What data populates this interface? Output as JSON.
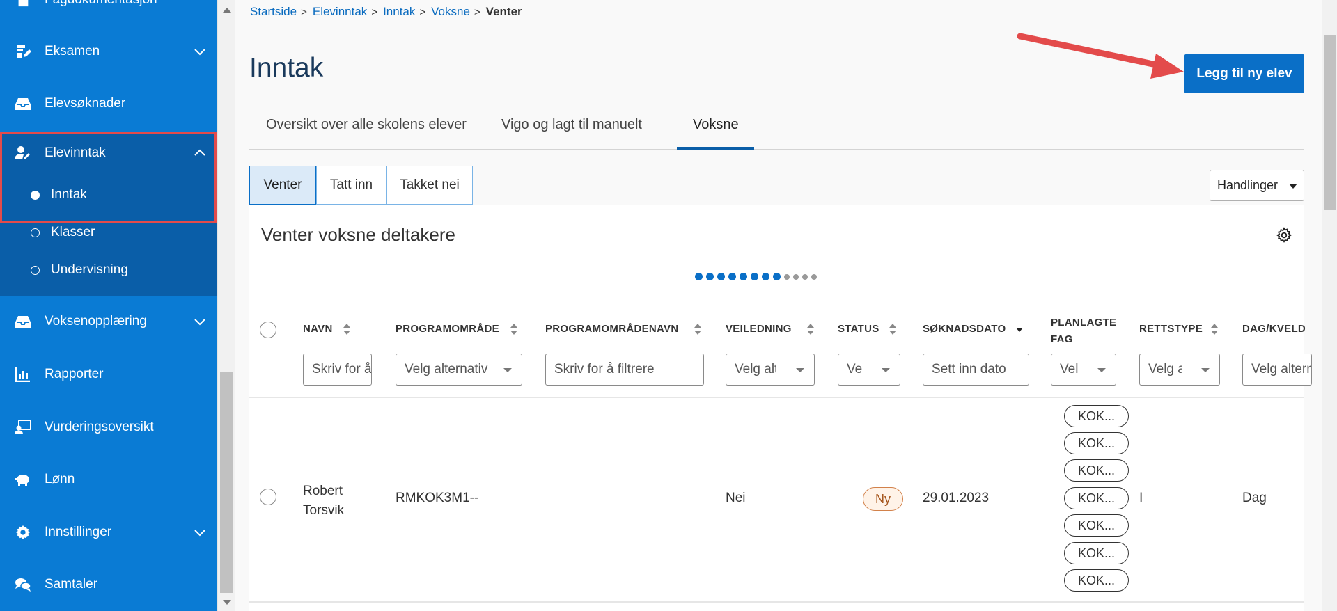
{
  "sidebar": {
    "items": [
      {
        "label": "Fagdokumentasjon",
        "icon": "document-icon"
      },
      {
        "label": "Eksamen",
        "icon": "exam-edit-icon"
      },
      {
        "label": "Elevsøknader",
        "icon": "inbox-icon"
      },
      {
        "label": "Elevinntak",
        "icon": "user-edit-icon"
      },
      {
        "label": "Voksenopplæring",
        "icon": "inbox-icon"
      },
      {
        "label": "Rapporter",
        "icon": "bar-chart-icon"
      },
      {
        "label": "Vurderingsoversikt",
        "icon": "assessment-icon"
      },
      {
        "label": "Lønn",
        "icon": "piggy-bank-icon"
      },
      {
        "label": "Innstillinger",
        "icon": "gear-icon"
      },
      {
        "label": "Samtaler",
        "icon": "chat-icon"
      }
    ],
    "sub_items": [
      {
        "label": "Inntak",
        "active": true
      },
      {
        "label": "Klasser",
        "active": false
      },
      {
        "label": "Undervisning",
        "active": false
      }
    ],
    "color": "#0a7bd4",
    "sub_color": "#0a5ea8",
    "highlight_color": "#e34b4b"
  },
  "breadcrumb": [
    "Startside",
    "Elevinntak",
    "Inntak",
    "Voksne",
    "Venter"
  ],
  "page_title": "Inntak",
  "add_button": "Legg til ny elev",
  "tabs": [
    "Oversikt over alle skolens elever",
    "Vigo og lagt til manuelt",
    "Voksne"
  ],
  "segments": [
    "Venter",
    "Tatt inn",
    "Takket nei"
  ],
  "actions_button": "Handlinger",
  "card_title": "Venter voksne deltakere",
  "pager": {
    "total": 12,
    "filled": 8
  },
  "columns": [
    {
      "header": "NAVN",
      "filter": "Skriv for å filtrere"
    },
    {
      "header": "PROGRAMOMRÅDE",
      "filter": "Velg alternativ"
    },
    {
      "header": "PROGRAMOMRÅDENAVN",
      "filter": "Skriv for å filtrere"
    },
    {
      "header": "VEILEDNING",
      "filter": "Velg alternativ"
    },
    {
      "header": "STATUS",
      "filter": "Velg alternativ"
    },
    {
      "header": "SØKNADSDATO",
      "filter": "Sett inn dato"
    },
    {
      "header": "PLANLAGTE FAG",
      "filter": "Velg alternativ"
    },
    {
      "header": "RETTSTYPE",
      "filter": "Velg alternativ"
    },
    {
      "header": "DAG/KVELD",
      "filter": "Velg alternativ"
    }
  ],
  "rows": [
    {
      "navn_first": "Robert",
      "navn_last": "Torsvik",
      "programomrade": "RMKOK3M1--",
      "veiledning": "Nei",
      "status": "Ny",
      "soknadsdato": "29.01.2023",
      "planlagte_fag": [
        "KOK...",
        "KOK...",
        "KOK...",
        "KOK...",
        "KOK...",
        "KOK...",
        "KOK..."
      ],
      "rettstype": "I",
      "dag_kveld": "Dag"
    }
  ],
  "colors": {
    "primary": "#0a6fc7",
    "title": "#1a3a5c",
    "annotation_arrow": "#e34b4b",
    "badge_border": "#d2814a"
  }
}
